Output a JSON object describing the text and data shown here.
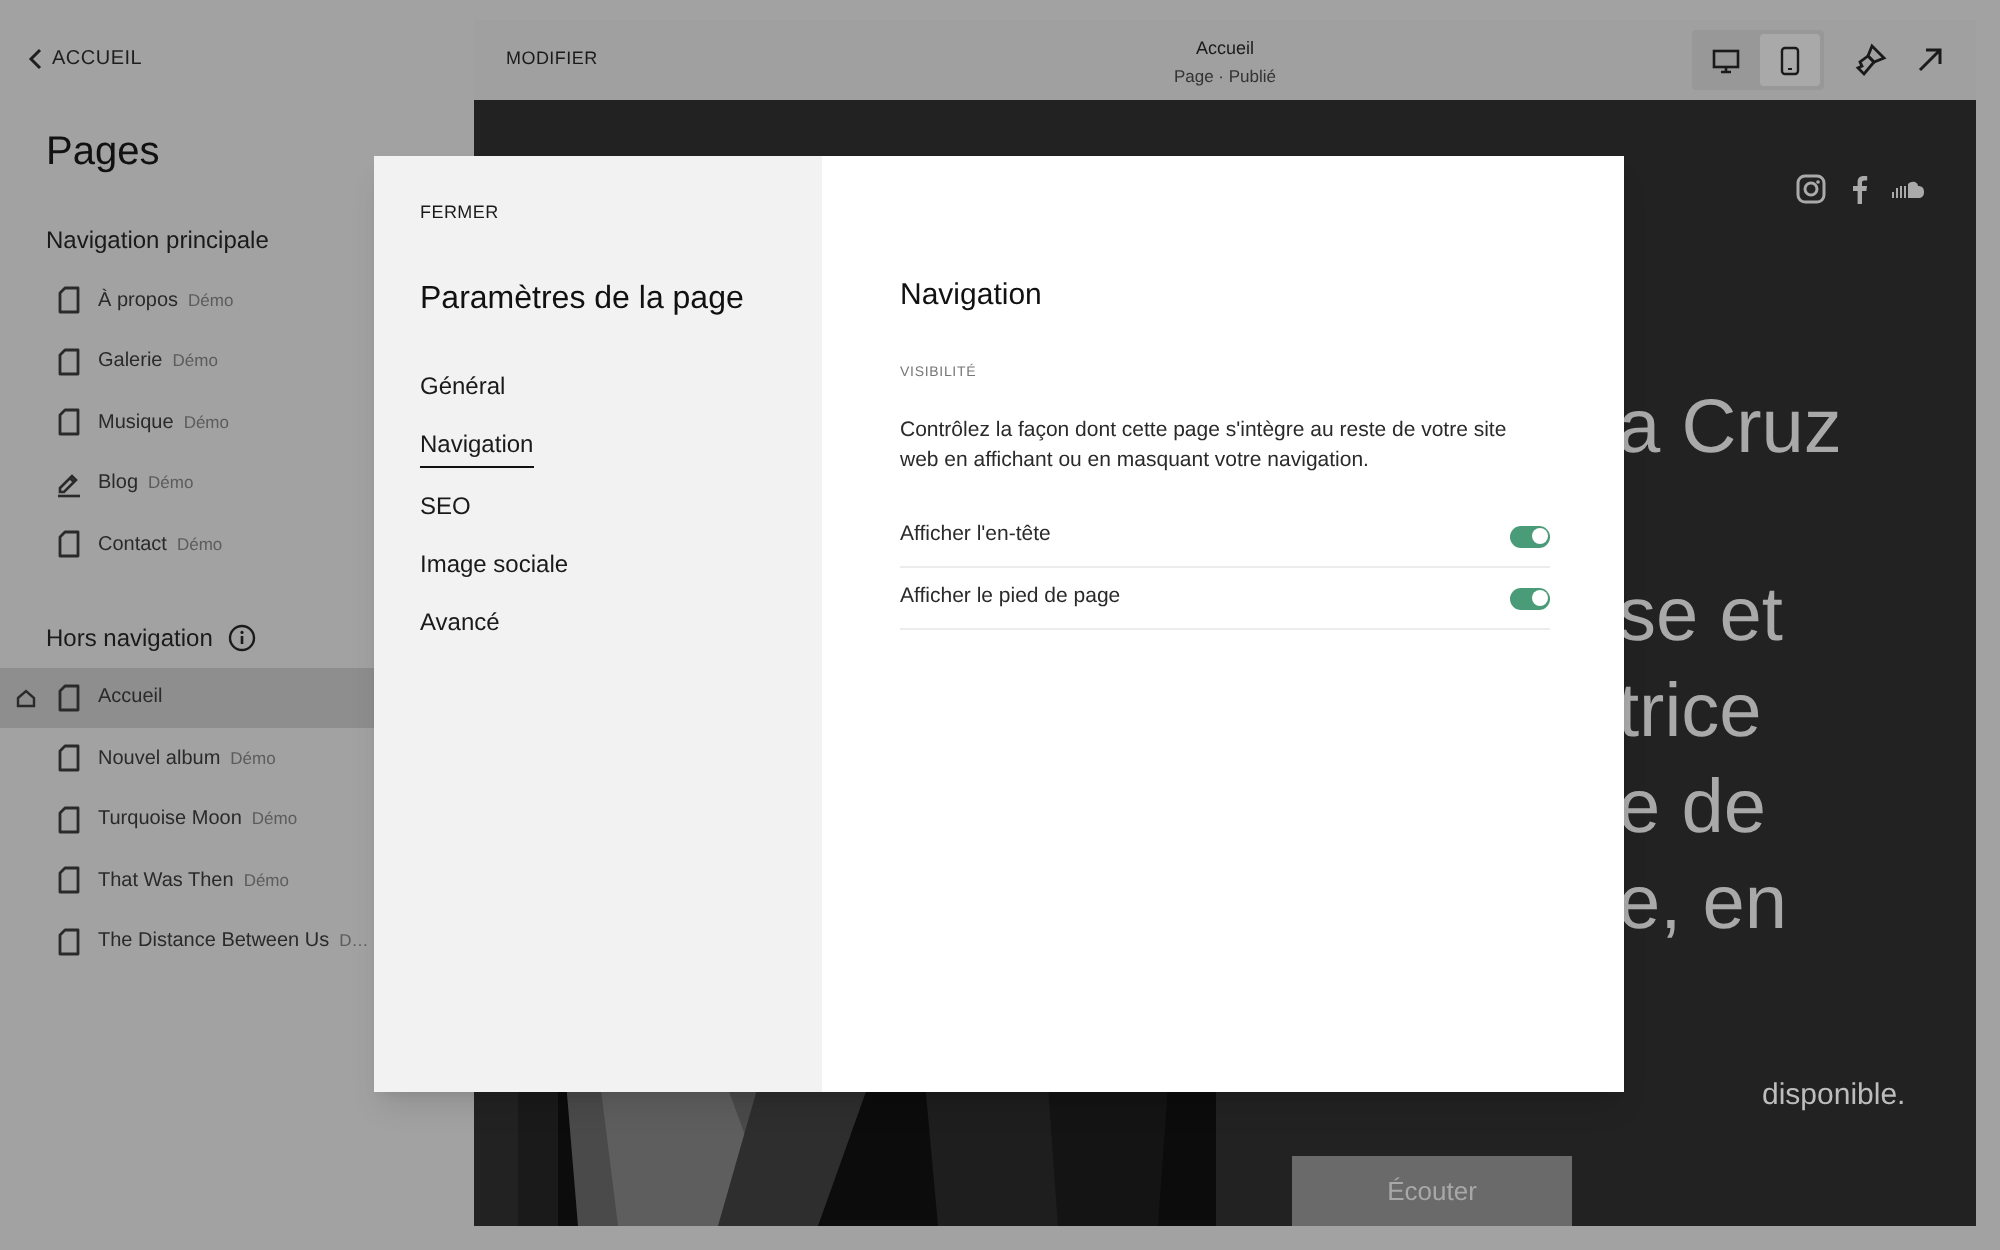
{
  "sidebar": {
    "back": "ACCUEIL",
    "title": "Pages",
    "sections": [
      {
        "title": "Navigation principale",
        "info": false,
        "items": [
          {
            "label": "À propos",
            "tag": "Démo",
            "kind": "page",
            "selected": false
          },
          {
            "label": "Galerie",
            "tag": "Démo",
            "kind": "page",
            "selected": false
          },
          {
            "label": "Musique",
            "tag": "Démo",
            "kind": "page",
            "selected": false
          },
          {
            "label": "Blog",
            "tag": "Démo",
            "kind": "blog",
            "selected": false
          },
          {
            "label": "Contact",
            "tag": "Démo",
            "kind": "page",
            "selected": false
          }
        ]
      },
      {
        "title": "Hors navigation",
        "info": true,
        "items": [
          {
            "label": "Accueil",
            "kind": "page",
            "home": true,
            "selected": true
          },
          {
            "label": "Nouvel album",
            "tag": "Démo",
            "kind": "page",
            "selected": false
          },
          {
            "label": "Turquoise Moon",
            "tag": "Démo",
            "kind": "page",
            "selected": false
          },
          {
            "label": "That Was Then",
            "tag": "Démo",
            "kind": "page",
            "selected": false
          },
          {
            "label": "The Distance Between Us",
            "tag": "D…",
            "kind": "page",
            "selected": false
          }
        ]
      }
    ]
  },
  "toolbar": {
    "mode": "MODIFIER",
    "page_title": "Accueil",
    "page_status": "Page · Publié",
    "views": [
      {
        "kind": "desktop",
        "selected": false
      },
      {
        "kind": "mobile",
        "selected": true
      }
    ]
  },
  "preview": {
    "hero_fragments": [
      "a Cruz",
      "se et",
      "trice",
      "e de",
      "e, en"
    ],
    "subtitle": "disponible.",
    "button": "Écouter"
  },
  "modal": {
    "close": "FERMER",
    "title": "Paramètres de la page",
    "menu_groups": [
      [
        {
          "label": "Général",
          "selected": false
        },
        {
          "label": "Navigation",
          "selected": true
        }
      ],
      [
        {
          "label": "SEO",
          "selected": false
        },
        {
          "label": "Image sociale",
          "selected": false
        },
        {
          "label": "Avancé",
          "selected": false
        }
      ]
    ],
    "heading": "Navigation",
    "section": "VISIBILITÉ",
    "description": "Contrôlez la façon dont cette page s'intègre au reste de votre site web en affichant ou en masquant votre navigation.",
    "toggles": [
      {
        "label": "Afficher l'en-tête",
        "on": true
      },
      {
        "label": "Afficher le pied de page",
        "on": true
      }
    ]
  }
}
